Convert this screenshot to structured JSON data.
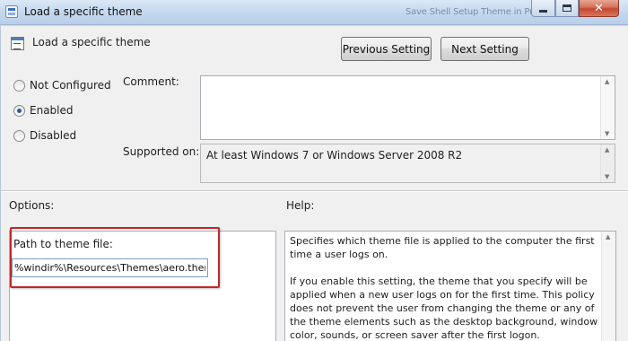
{
  "window": {
    "title": "Load a specific theme",
    "background_fragment": "Save Shell Setup Theme in Pres..."
  },
  "header": {
    "setting_title": "Load a specific theme",
    "prev_label": "Previous Setting",
    "next_label": "Next Setting"
  },
  "state": {
    "options": [
      {
        "label": "Not Configured",
        "checked": false
      },
      {
        "label": "Enabled",
        "checked": true
      },
      {
        "label": "Disabled",
        "checked": false
      }
    ]
  },
  "fields": {
    "comment_label": "Comment:",
    "comment_value": "",
    "supported_label": "Supported on:",
    "supported_value": "At least Windows 7 or Windows Server 2008 R2"
  },
  "options_pane": {
    "title": "Options:",
    "path_label": "Path to theme file:",
    "path_value": "%windir%\\Resources\\Themes\\aero.theme"
  },
  "help_pane": {
    "title": "Help:",
    "paragraphs": [
      "Specifies which theme file is applied to the computer the first time a user logs on.",
      "If you enable this setting, the theme that you specify will be applied when a new user logs on for the first time.  This policy does not prevent the user from changing the theme or any of the theme elements such as the desktop background, window color, sounds, or screen saver after the first logon."
    ]
  },
  "colors": {
    "highlight": "#c1272d",
    "close_button": "#c3482f",
    "titlebar": "#c4d7ee"
  }
}
